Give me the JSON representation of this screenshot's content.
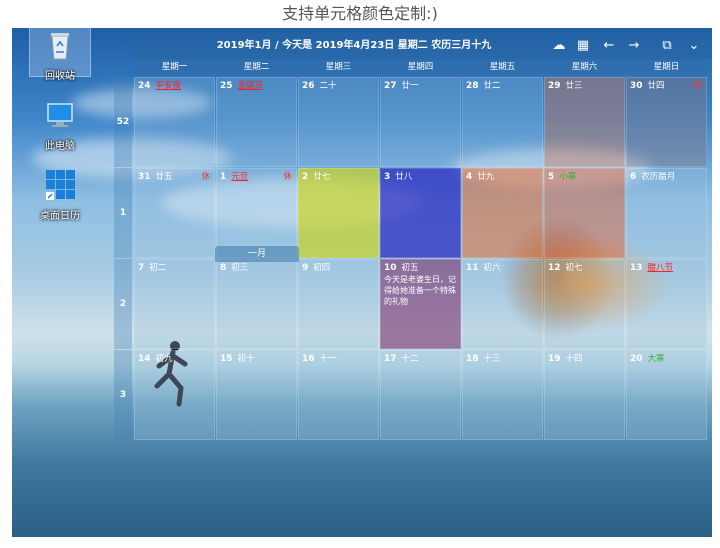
{
  "caption": "支持单元格颜色定制:)",
  "desktop_icons": [
    {
      "label": "回收站",
      "icon": "recycle-bin-icon"
    },
    {
      "label": "此电脑",
      "icon": "computer-icon"
    },
    {
      "label": "桌面日历",
      "icon": "desktop-calendar-icon"
    }
  ],
  "toolbar": {
    "title": "2019年1月 / 今天是 2019年4月23日 星期二 农历三月十九",
    "icons": [
      "cloud-sync-icon",
      "calendar-icon",
      "arrow-left-icon",
      "arrow-right-icon",
      "display-icon",
      "chevron-down-icon"
    ]
  },
  "weekdays": [
    "星期一",
    "星期二",
    "星期三",
    "星期四",
    "星期五",
    "星期六",
    "星期日"
  ],
  "month_tab": "一月",
  "weeks": [
    {
      "num": "52",
      "days": [
        {
          "d": "24",
          "l": "平安夜",
          "style": "hol"
        },
        {
          "d": "25",
          "l": "圣诞节",
          "style": "hol"
        },
        {
          "d": "26",
          "l": "二十"
        },
        {
          "d": "27",
          "l": "廿一"
        },
        {
          "d": "28",
          "l": "廿二"
        },
        {
          "d": "29",
          "l": "廿三",
          "color": "rgba(200,120,90,0.45)"
        },
        {
          "d": "30",
          "l": "廿四",
          "rest": "休",
          "color": "rgba(130,120,130,0.45)"
        }
      ]
    },
    {
      "num": "1",
      "days": [
        {
          "d": "31",
          "l": "廿五",
          "rest": "休"
        },
        {
          "d": "1",
          "l": "元旦",
          "style": "hol",
          "rest": "休"
        },
        {
          "d": "2",
          "l": "廿七",
          "color": "rgba(200,210,40,0.72)"
        },
        {
          "d": "3",
          "l": "廿八",
          "color": "rgba(40,40,190,0.72)"
        },
        {
          "d": "4",
          "l": "廿九",
          "color": "rgba(230,110,50,0.55)"
        },
        {
          "d": "5",
          "l": "小寒",
          "style": "grn",
          "color": "rgba(220,100,60,0.5)"
        },
        {
          "d": "6",
          "l": "农历腊月"
        }
      ]
    },
    {
      "num": "2",
      "days": [
        {
          "d": "7",
          "l": "初二"
        },
        {
          "d": "8",
          "l": "初三"
        },
        {
          "d": "9",
          "l": "初四"
        },
        {
          "d": "10",
          "l": "初五",
          "color": "rgba(120,50,110,0.6)",
          "note": "今天是老婆生日，记得给她准备一个特殊的礼物"
        },
        {
          "d": "11",
          "l": "初六"
        },
        {
          "d": "12",
          "l": "初七"
        },
        {
          "d": "13",
          "l": "腊八节",
          "style": "hol"
        }
      ]
    },
    {
      "num": "3",
      "days": [
        {
          "d": "14",
          "l": "初九"
        },
        {
          "d": "15",
          "l": "初十"
        },
        {
          "d": "16",
          "l": "十一"
        },
        {
          "d": "17",
          "l": "十二"
        },
        {
          "d": "18",
          "l": "十三"
        },
        {
          "d": "19",
          "l": "十四"
        },
        {
          "d": "20",
          "l": "大寒",
          "style": "grn"
        }
      ]
    }
  ]
}
